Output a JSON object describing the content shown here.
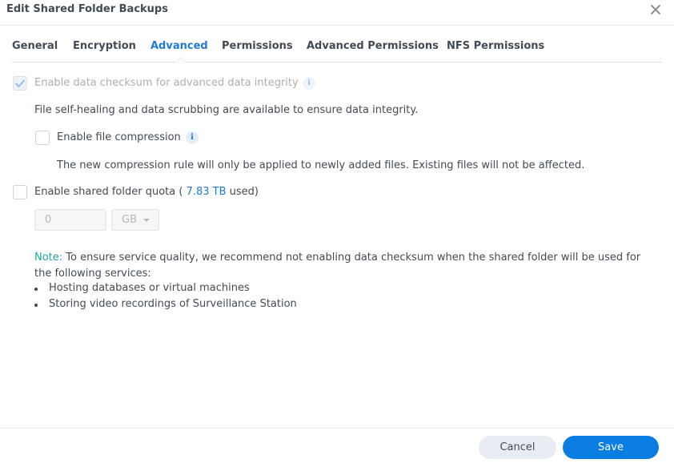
{
  "window": {
    "title": "Edit Shared Folder Backups",
    "close_icon": "close-icon"
  },
  "tabs": [
    {
      "label": "General",
      "active": false
    },
    {
      "label": "Encryption",
      "active": false
    },
    {
      "label": "Advanced",
      "active": true
    },
    {
      "label": "Permissions",
      "active": false
    },
    {
      "label": "Advanced Permissions",
      "active": false
    },
    {
      "label": "NFS Permissions",
      "active": false
    }
  ],
  "advanced": {
    "checksum": {
      "label": "Enable data checksum for advanced data integrity",
      "checked": true,
      "disabled": true,
      "info_icon": "info-icon"
    },
    "checksum_description": "File self-healing and data scrubbing are available to ensure data integrity.",
    "compression": {
      "label": "Enable file compression",
      "checked": false,
      "info_icon": "info-icon"
    },
    "compression_description": "The new compression rule will only be applied to newly added files. Existing files will not be affected.",
    "quota": {
      "label": "Enable shared folder quota",
      "open_paren": "(",
      "used_value": "7.83 TB",
      "used_suffix": "used)",
      "checked": false,
      "size_value": "0",
      "unit_selected": "GB"
    },
    "note": {
      "label": "Note:",
      "text": "To ensure service quality, we recommend not enabling data checksum when the shared folder will be used for the following services:",
      "items": [
        "Hosting databases or virtual machines",
        "Storing video recordings of Surveillance Station"
      ]
    }
  },
  "footer": {
    "cancel_label": "Cancel",
    "save_label": "Save"
  },
  "colors": {
    "accent": "#1f7ad6",
    "primary_button": "#0a7de3",
    "note_label": "#21a7a0"
  }
}
